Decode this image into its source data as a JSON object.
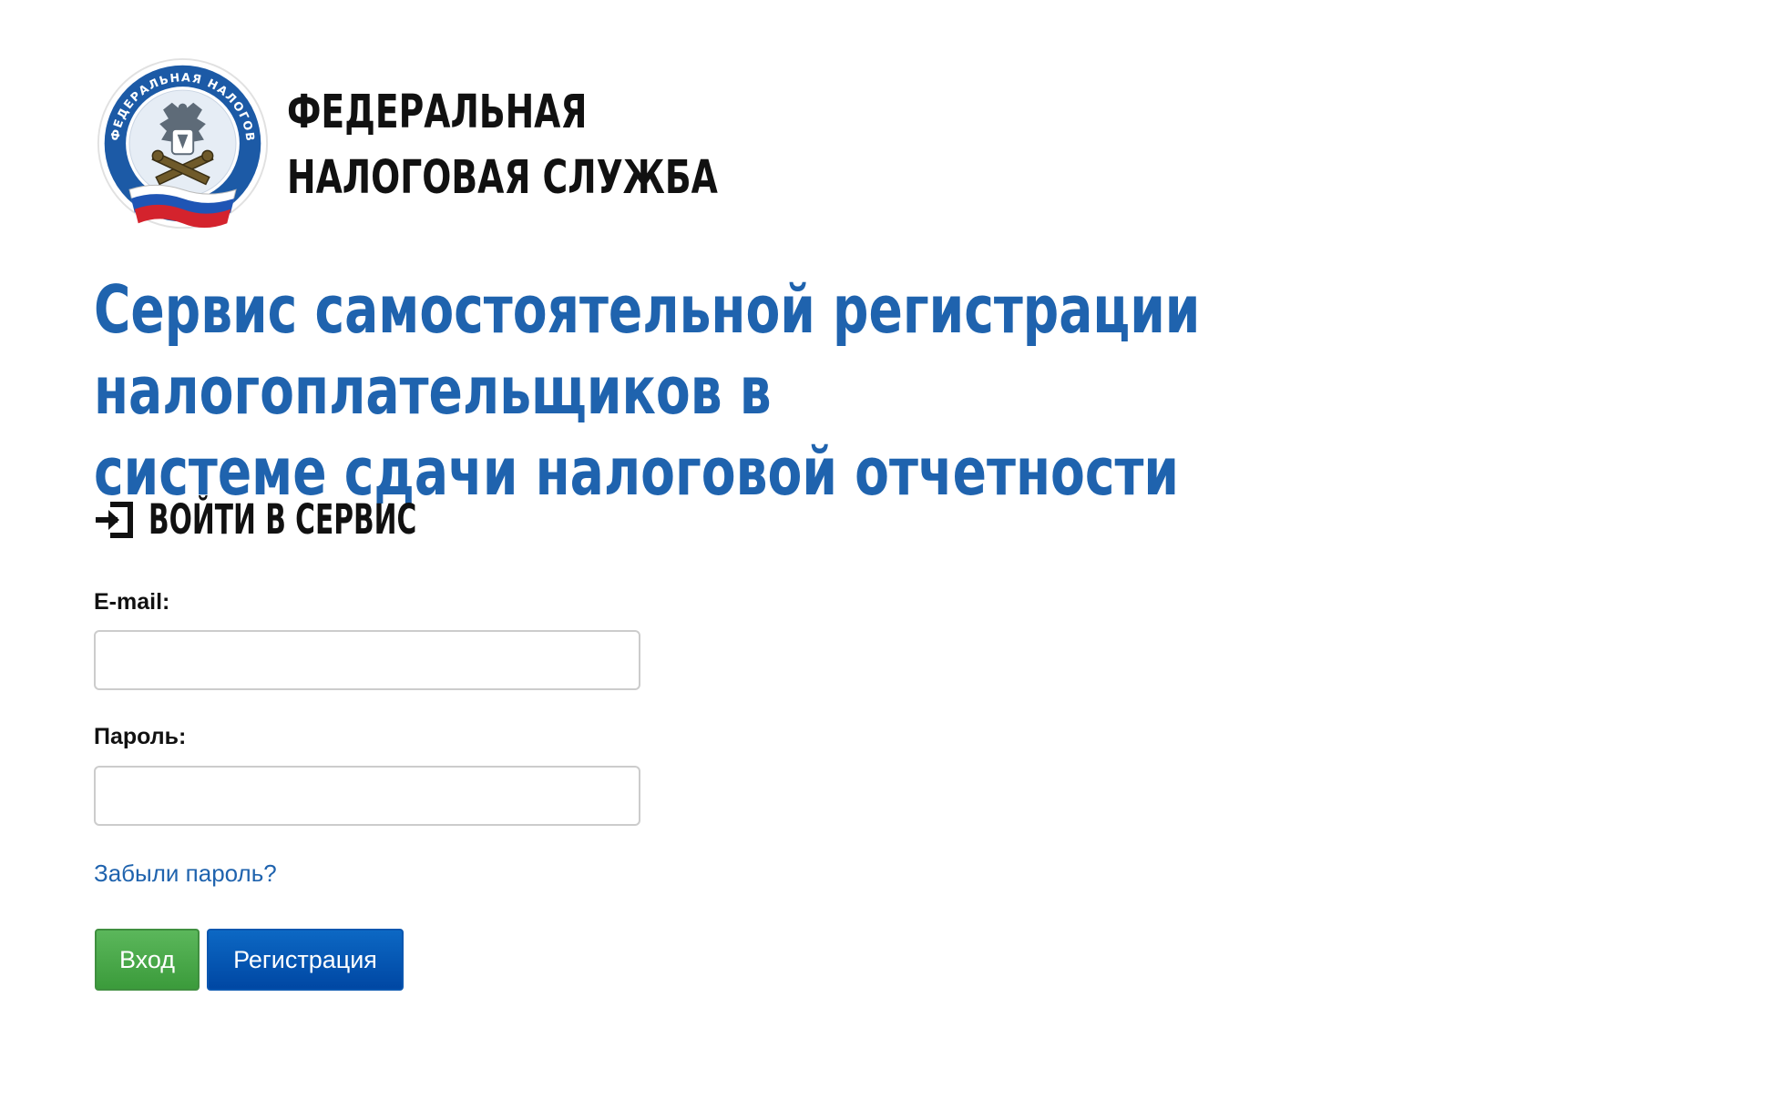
{
  "header": {
    "emblem_icon": "fns-emblem-icon",
    "emblem_text": "ФЕДЕРАЛЬНАЯ НАЛОГОВАЯ СЛУЖБА",
    "org_name_line1": "ФЕДЕРАЛЬНАЯ",
    "org_name_line2": "НАЛОГОВАЯ СЛУЖБА"
  },
  "page": {
    "title_line1": "Сервис самостоятельной регистрации налогоплательщиков в",
    "title_line2": "системе сдачи налоговой отчетности"
  },
  "login": {
    "icon": "sign-in-icon",
    "heading": "ВОЙТИ В СЕРВИС",
    "email_label": "E-mail:",
    "email_value": "",
    "password_label": "Пароль:",
    "password_value": "",
    "forgot_password": "Забыли пароль?",
    "login_button": "Вход",
    "register_button": "Регистрация"
  },
  "colors": {
    "title_blue": "#1f63ae",
    "login_green": "#4cae4c",
    "register_blue": "#0d5ab6"
  }
}
